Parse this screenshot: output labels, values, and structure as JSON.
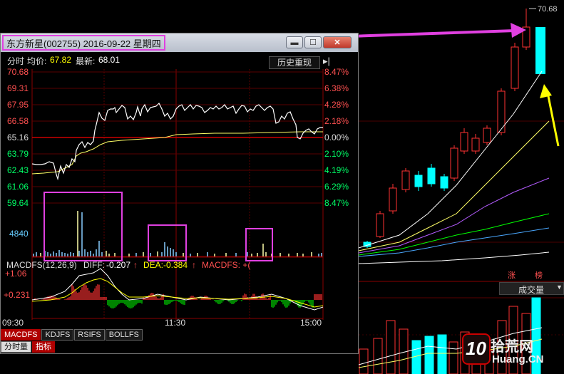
{
  "window": {
    "title": "东方新星(002755) 2016-09-22 星期四",
    "btn_minimize": "▬",
    "btn_maximize": "☐",
    "btn_close": "✕"
  },
  "info": {
    "mode_label": "分时",
    "avg_label": "均价:",
    "avg_value": "67.82",
    "latest_label": "最新:",
    "latest_value": "68.01",
    "history_button": "历史重现",
    "history_icon": "chevron-right-end-icon"
  },
  "price_axis": {
    "left": [
      "70.68",
      "69.31",
      "67.95",
      "66.58",
      "65.16",
      "63.79",
      "62.43",
      "61.06",
      "59.64"
    ],
    "right": [
      "8.47%",
      "6.38%",
      "4.28%",
      "2.18%",
      "0.00%",
      "2.10%",
      "4.19%",
      "6.29%",
      "8.47%"
    ]
  },
  "volume_axis": {
    "label": "4840"
  },
  "macd": {
    "title": "MACDFS(12,26,9)",
    "diff_label": "DIFF:",
    "diff_value": "-0.207",
    "dea_label": "DEA:",
    "dea_value": "-0.384",
    "macdfs_label": "MACDFS: +(",
    "axis": [
      "+1.06",
      "+0.231"
    ]
  },
  "time_axis": [
    "09:30",
    "11:30",
    "15:00"
  ],
  "indicator_tabs": [
    "MACDFS",
    "KDJFS",
    "RSIFS",
    "BOLLFS"
  ],
  "bottom_tabs": [
    "分时量",
    "指标"
  ],
  "right_panel": {
    "high_price": "70.68",
    "tag_zhang": "涨",
    "tag_bang": "榜",
    "volume_select": "成交量",
    "watermark_10": "10",
    "watermark_site": "拾荒网",
    "watermark_domain": "Huang.CN"
  },
  "colors": {
    "up": "#ff3232",
    "down": "#00ffff",
    "magenta": "#e040e0",
    "yellow": "#ffff00",
    "white": "#ffffff",
    "purple": "#b45cff",
    "green": "#00ff00",
    "blue": "#4aa8ff"
  }
}
